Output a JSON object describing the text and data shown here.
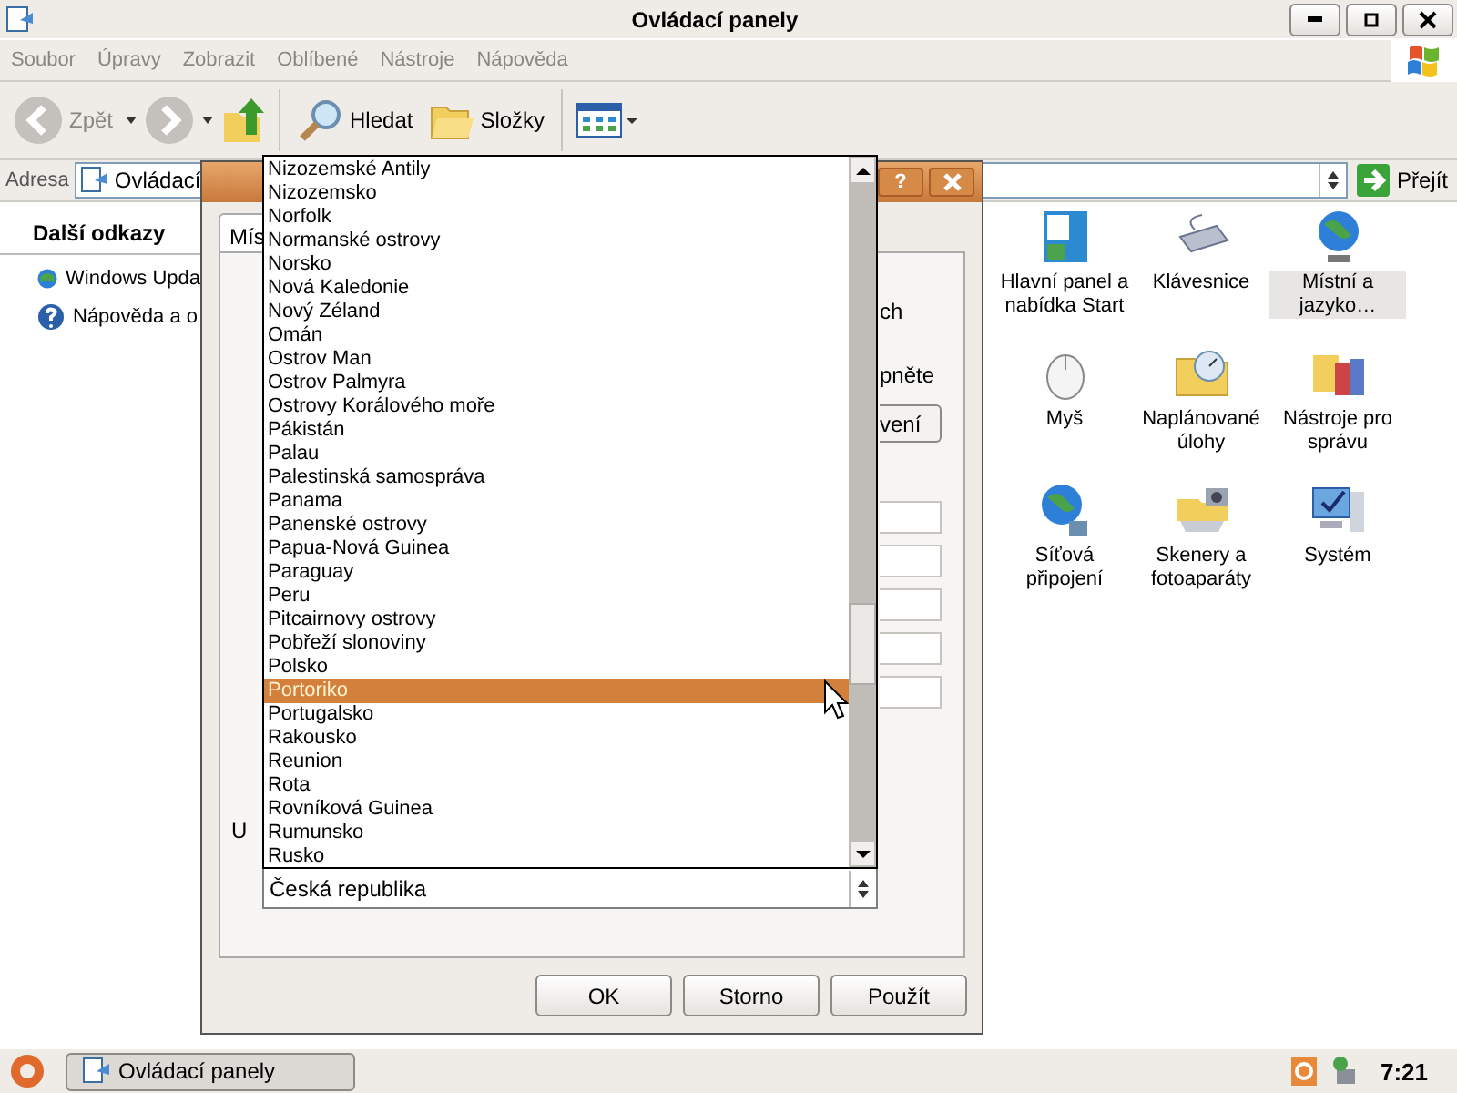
{
  "window": {
    "title": "Ovládací panely"
  },
  "menu": [
    {
      "label": "Soubor",
      "disabled": true
    },
    {
      "label": "Úpravy",
      "disabled": true
    },
    {
      "label": "Zobrazit",
      "disabled": true
    },
    {
      "label": "Oblíbené",
      "disabled": true
    },
    {
      "label": "Nástroje",
      "disabled": true
    },
    {
      "label": "Nápověda",
      "disabled": true
    }
  ],
  "toolbar": {
    "back": {
      "label": "Zpět",
      "disabled": true
    },
    "search": "Hledat",
    "folders": "Složky"
  },
  "address": {
    "label": "Adresa",
    "value": "Ovládací",
    "go": "Přejít"
  },
  "sidebar": {
    "title": "Další odkazy",
    "links": [
      "Windows Upda",
      "Nápověda a o"
    ]
  },
  "items": [
    {
      "label": "Hlavní panel a nabídka Start",
      "selected": false
    },
    {
      "label": "Klávesnice",
      "selected": false
    },
    {
      "label": "Místní a jazyko…",
      "selected": true
    },
    {
      "label": "Myš",
      "selected": false
    },
    {
      "label": "Naplánované úlohy",
      "selected": false
    },
    {
      "label": "Nástroje pro správu",
      "selected": false
    },
    {
      "label": "Síťová připojení",
      "selected": false
    },
    {
      "label": "Skenery a fotoaparáty",
      "selected": false
    },
    {
      "label": "Systém",
      "selected": false
    }
  ],
  "dialog": {
    "help": "?",
    "tab": "Mís",
    "texts": [
      "ch",
      "pněte"
    ],
    "button": "vení",
    "label": "U",
    "buttons": [
      "OK",
      "Storno",
      "Použít"
    ]
  },
  "dropdown": {
    "value": "Česká republika",
    "options": [
      {
        "label": "Nizozemské Antily",
        "selected": false
      },
      {
        "label": "Nizozemsko",
        "selected": false
      },
      {
        "label": "Norfolk",
        "selected": false
      },
      {
        "label": "Normanské ostrovy",
        "selected": false
      },
      {
        "label": "Norsko",
        "selected": false
      },
      {
        "label": "Nová Kaledonie",
        "selected": false
      },
      {
        "label": "Nový Zéland",
        "selected": false
      },
      {
        "label": "Omán",
        "selected": false
      },
      {
        "label": "Ostrov Man",
        "selected": false
      },
      {
        "label": "Ostrov Palmyra",
        "selected": false
      },
      {
        "label": "Ostrovy Korálového moře",
        "selected": false
      },
      {
        "label": "Pákistán",
        "selected": false
      },
      {
        "label": "Palau",
        "selected": false
      },
      {
        "label": "Palestinská samospráva",
        "selected": false
      },
      {
        "label": "Panama",
        "selected": false
      },
      {
        "label": "Panenské ostrovy",
        "selected": false
      },
      {
        "label": "Papua-Nová Guinea",
        "selected": false
      },
      {
        "label": "Paraguay",
        "selected": false
      },
      {
        "label": "Peru",
        "selected": false
      },
      {
        "label": "Pitcairnovy ostrovy",
        "selected": false
      },
      {
        "label": "Pobřeží slonoviny",
        "selected": false
      },
      {
        "label": "Polsko",
        "selected": false
      },
      {
        "label": "Portoriko",
        "selected": true
      },
      {
        "label": "Portugalsko",
        "selected": false
      },
      {
        "label": "Rakousko",
        "selected": false
      },
      {
        "label": "Reunion",
        "selected": false
      },
      {
        "label": "Rota",
        "selected": false
      },
      {
        "label": "Rovníková Guinea",
        "selected": false
      },
      {
        "label": "Rumunsko",
        "selected": false
      },
      {
        "label": "Rusko",
        "selected": false
      }
    ]
  },
  "taskbar": {
    "task": "Ovládací panely",
    "clock": "7:21"
  }
}
